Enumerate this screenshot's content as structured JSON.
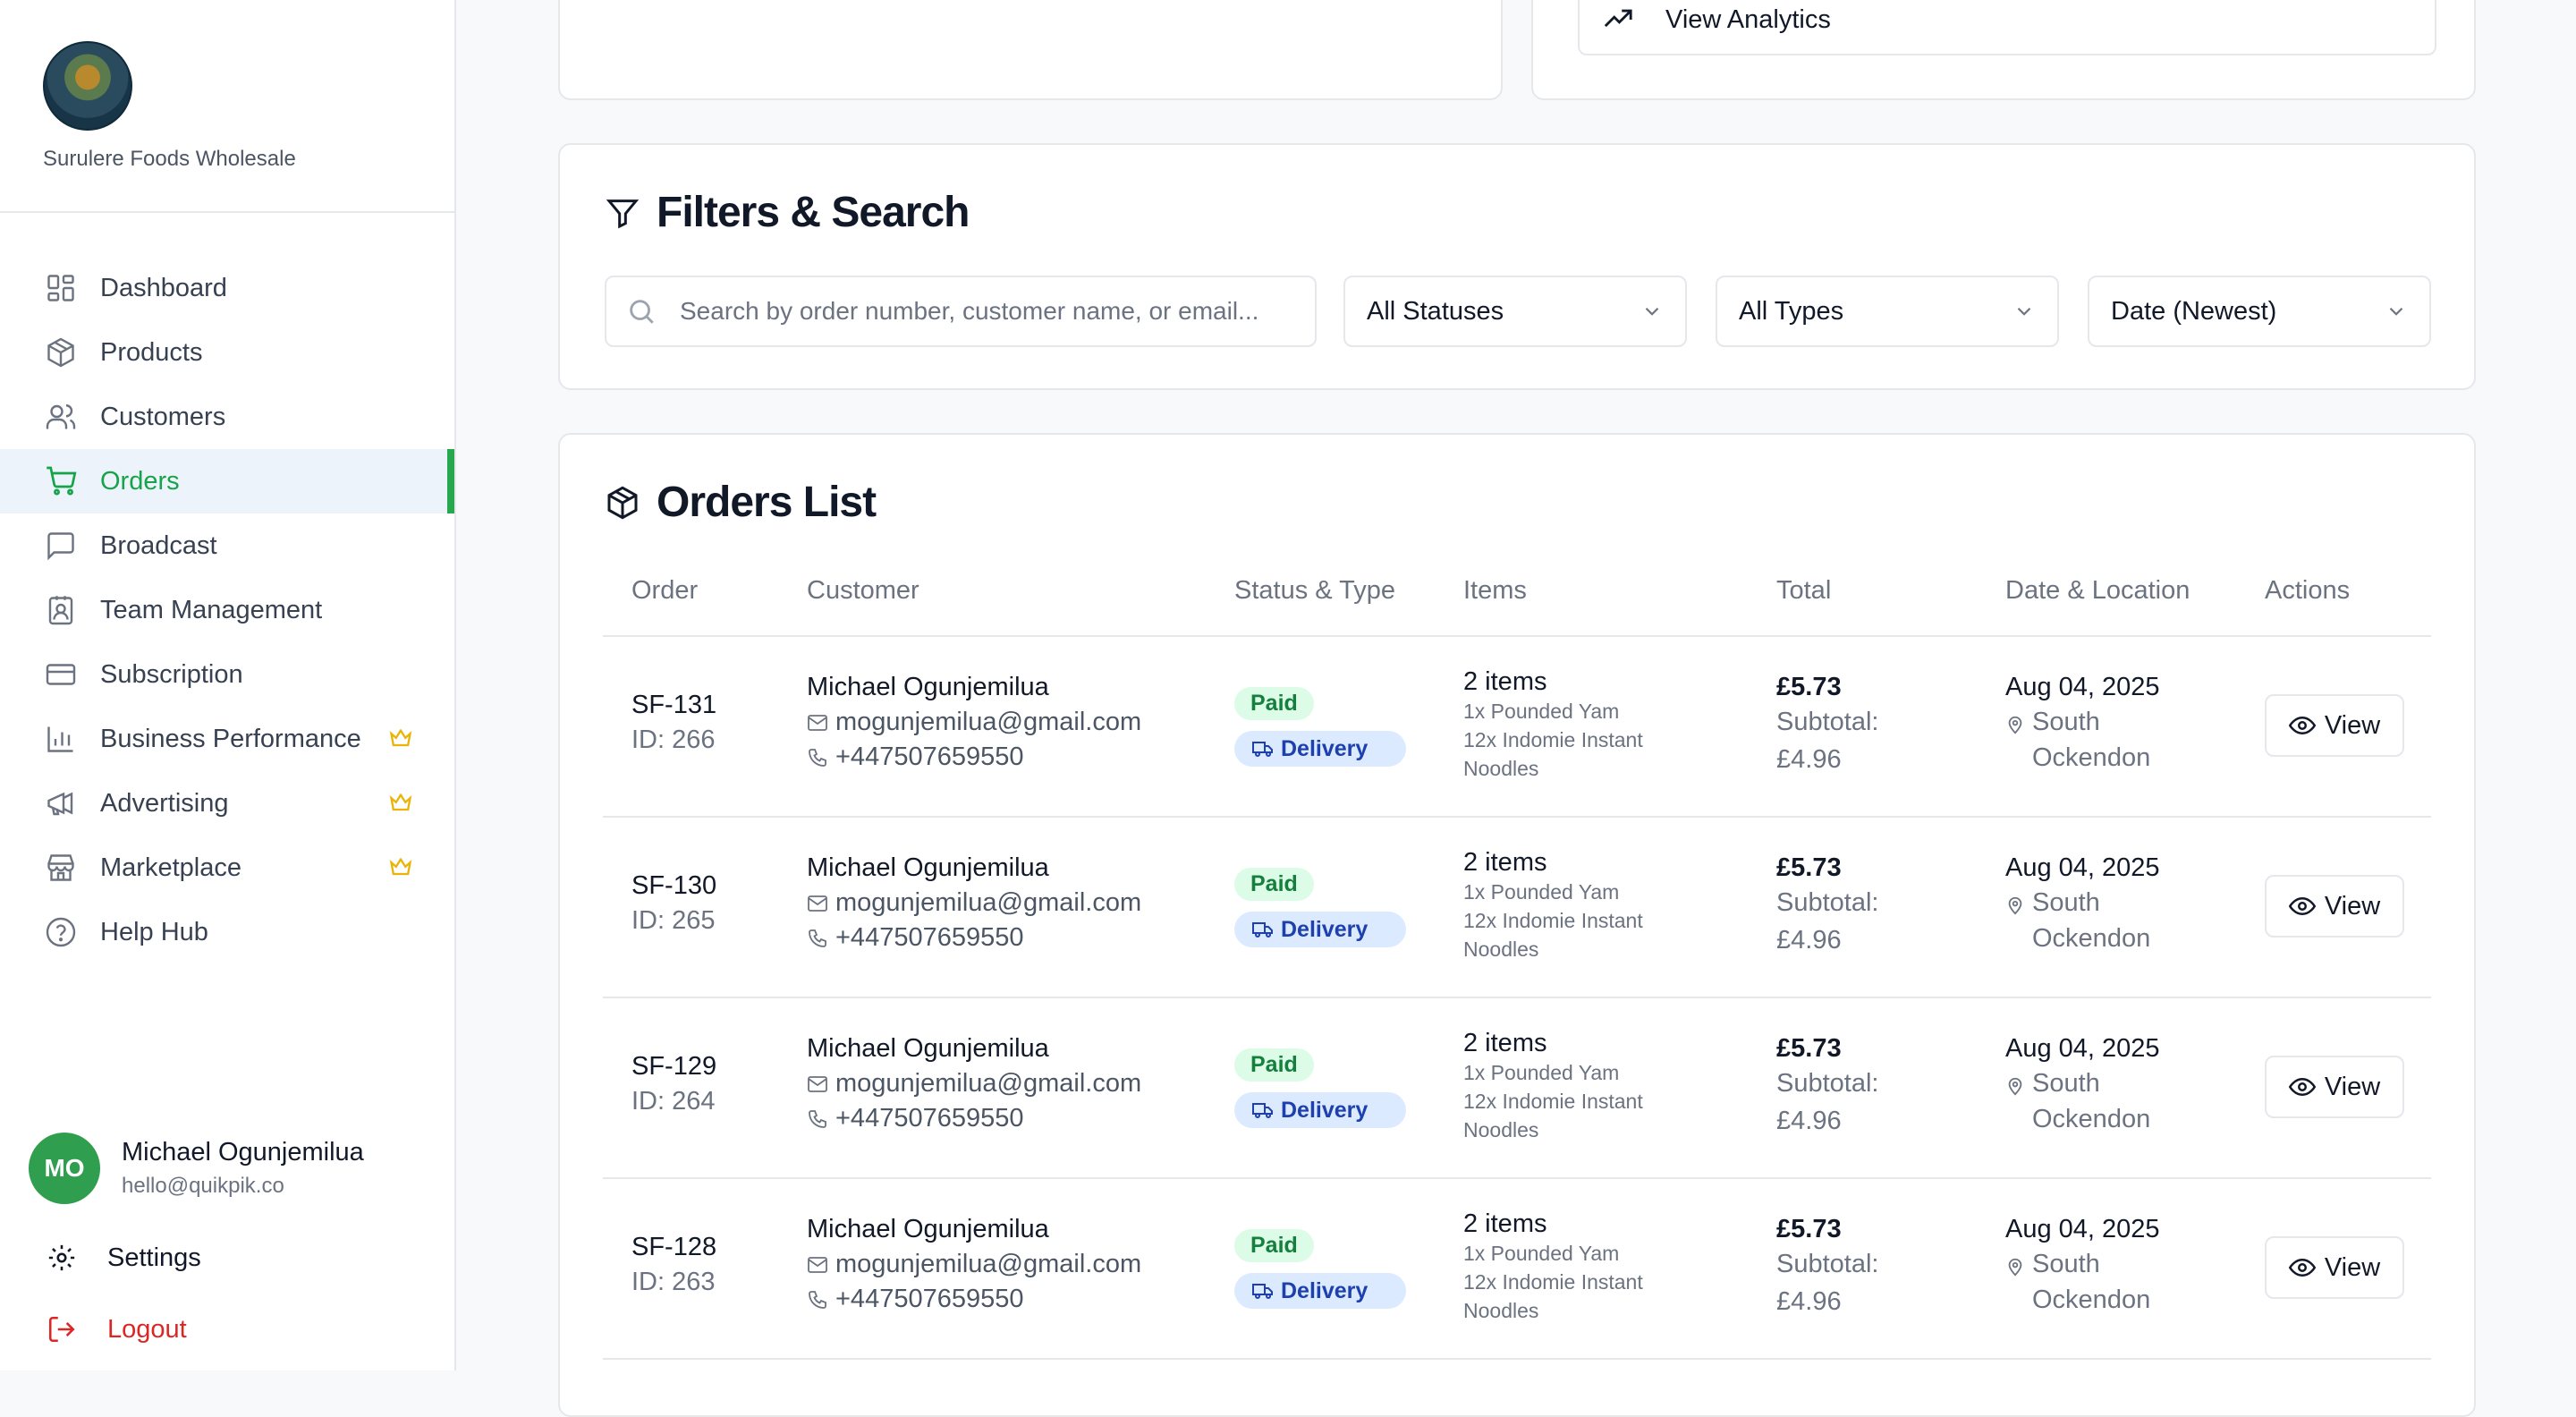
{
  "brand": {
    "name": "Surulere Foods Wholesale"
  },
  "sidebar": {
    "items": [
      {
        "label": "Dashboard",
        "icon": "dashboard-icon"
      },
      {
        "label": "Products",
        "icon": "box-icon"
      },
      {
        "label": "Customers",
        "icon": "users-icon"
      },
      {
        "label": "Orders",
        "icon": "cart-icon",
        "active": true
      },
      {
        "label": "Broadcast",
        "icon": "message-square-icon"
      },
      {
        "label": "Team Management",
        "icon": "contact-icon"
      },
      {
        "label": "Subscription",
        "icon": "credit-card-icon"
      },
      {
        "label": "Business Performance",
        "icon": "bar-chart-icon",
        "premium": true
      },
      {
        "label": "Advertising",
        "icon": "megaphone-icon",
        "premium": true
      },
      {
        "label": "Marketplace",
        "icon": "store-icon",
        "premium": true
      },
      {
        "label": "Help Hub",
        "icon": "help-circle-icon"
      }
    ],
    "user": {
      "initials": "MO",
      "name": "Michael Ogunjemilua",
      "email": "hello@quikpik.co"
    },
    "settings_label": "Settings",
    "logout_label": "Logout"
  },
  "top": {
    "analytics_label": "View Analytics"
  },
  "filters": {
    "title": "Filters & Search",
    "search_placeholder": "Search by order number, customer name, or email...",
    "status_value": "All Statuses",
    "type_value": "All Types",
    "sort_value": "Date (Newest)"
  },
  "orders": {
    "title": "Orders List",
    "columns": [
      "Order",
      "Customer",
      "Status & Type",
      "Items",
      "Total",
      "Date & Location",
      "Actions"
    ],
    "view_label": "View",
    "rows": [
      {
        "order": "SF-131",
        "id": "ID: 266",
        "customer": "Michael Ogunjemilua",
        "email": "mogunjemilua@gmail.com",
        "phone": "+447507659550",
        "status": "Paid",
        "type": "Delivery",
        "items_count": "2 items",
        "items": [
          "1x Pounded Yam",
          "12x Indomie Instant",
          "Noodles"
        ],
        "total": "£5.73",
        "subtotal_label": "Subtotal:",
        "subtotal": "£4.96",
        "date": "Aug 04, 2025",
        "location": "South Ockendon"
      },
      {
        "order": "SF-130",
        "id": "ID: 265",
        "customer": "Michael Ogunjemilua",
        "email": "mogunjemilua@gmail.com",
        "phone": "+447507659550",
        "status": "Paid",
        "type": "Delivery",
        "items_count": "2 items",
        "items": [
          "1x Pounded Yam",
          "12x Indomie Instant",
          "Noodles"
        ],
        "total": "£5.73",
        "subtotal_label": "Subtotal:",
        "subtotal": "£4.96",
        "date": "Aug 04, 2025",
        "location": "South Ockendon"
      },
      {
        "order": "SF-129",
        "id": "ID: 264",
        "customer": "Michael Ogunjemilua",
        "email": "mogunjemilua@gmail.com",
        "phone": "+447507659550",
        "status": "Paid",
        "type": "Delivery",
        "items_count": "2 items",
        "items": [
          "1x Pounded Yam",
          "12x Indomie Instant",
          "Noodles"
        ],
        "total": "£5.73",
        "subtotal_label": "Subtotal:",
        "subtotal": "£4.96",
        "date": "Aug 04, 2025",
        "location": "South Ockendon"
      },
      {
        "order": "SF-128",
        "id": "ID: 263",
        "customer": "Michael Ogunjemilua",
        "email": "mogunjemilua@gmail.com",
        "phone": "+447507659550",
        "status": "Paid",
        "type": "Delivery",
        "items_count": "2 items",
        "items": [
          "1x Pounded Yam",
          "12x Indomie Instant",
          "Noodles"
        ],
        "total": "£5.73",
        "subtotal_label": "Subtotal:",
        "subtotal": "£4.96",
        "date": "Aug 04, 2025",
        "location": "South Ockendon"
      }
    ]
  },
  "colors": {
    "accent": "#16a34a",
    "active_bg": "#edf3fb",
    "premium": "#eab308",
    "logout": "#dc2626"
  }
}
